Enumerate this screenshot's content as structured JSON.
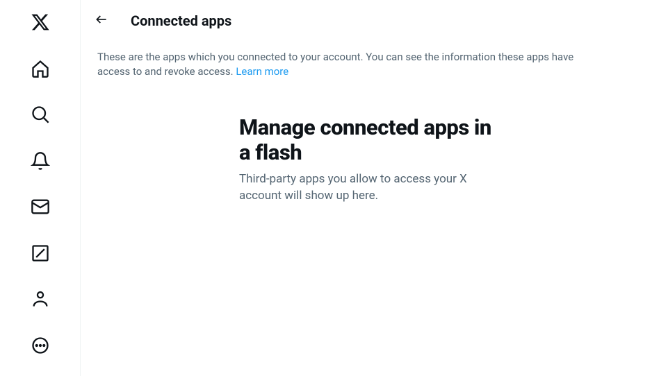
{
  "sidebar": {
    "items": [
      {
        "name": "x-logo"
      },
      {
        "name": "home"
      },
      {
        "name": "search"
      },
      {
        "name": "notifications"
      },
      {
        "name": "messages"
      },
      {
        "name": "grok"
      },
      {
        "name": "profile"
      },
      {
        "name": "more"
      }
    ]
  },
  "header": {
    "title": "Connected apps"
  },
  "description": {
    "text": "These are the apps which you connected to your account. You can see the information these apps have access to and revoke access. ",
    "link_text": "Learn more"
  },
  "empty_state": {
    "title": "Manage connected apps in a flash",
    "subtitle": "Third-party apps you allow to access your X account will show up here."
  }
}
